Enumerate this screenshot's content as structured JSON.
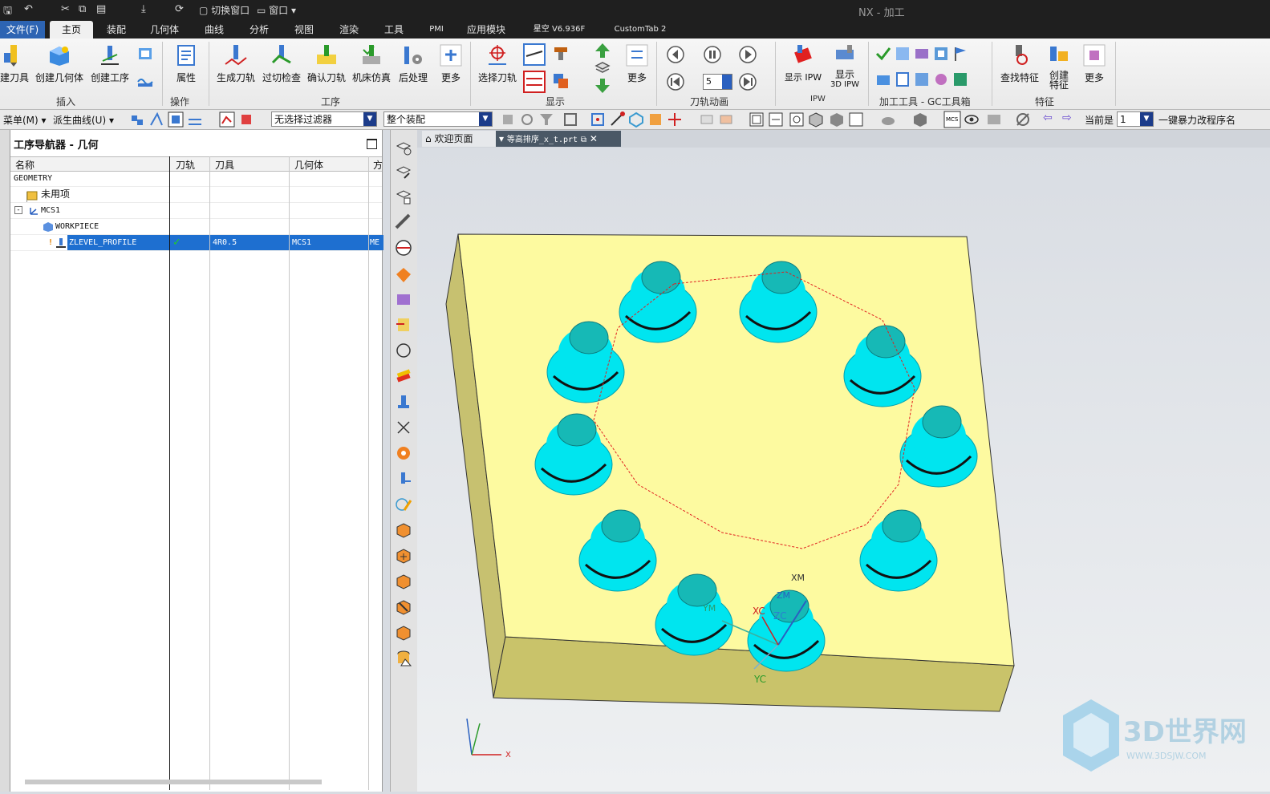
{
  "titlebar": {
    "app_title": "NX - 加工",
    "switch_window": "切换窗口",
    "window": "窗口"
  },
  "tabs": [
    {
      "label": "文件(F)"
    },
    {
      "label": "主页"
    },
    {
      "label": "装配"
    },
    {
      "label": "几何体"
    },
    {
      "label": "曲线"
    },
    {
      "label": "分析"
    },
    {
      "label": "视图"
    },
    {
      "label": "渲染"
    },
    {
      "label": "工具"
    },
    {
      "label": "PMI"
    },
    {
      "label": "应用模块"
    },
    {
      "label": "星空 V6.936F"
    },
    {
      "label": "CustomTab 2"
    }
  ],
  "ribbon": {
    "buttons": {
      "create_tool": "建刀具",
      "create_geometry": "创建几何体",
      "create_operation": "创建工序",
      "properties": "属性",
      "generate_toolpath": "生成刀轨",
      "gouge_check": "过切检查",
      "verify_toolpath": "确认刀轨",
      "machine_sim": "机床仿真",
      "postprocess": "后处理",
      "more1": "更多",
      "select_toolpath": "选择刀轨",
      "more2": "更多",
      "show_ipw": "显示 IPW",
      "show_3d_ipw_a": "显示",
      "show_3d_ipw_b": "3D IPW",
      "find_feature": "查找特征",
      "create_feature_a": "创建",
      "create_feature_b": "特征",
      "more3": "更多"
    },
    "groups": {
      "insert": "插入",
      "operation": "操作",
      "process": "工序",
      "display": "显示",
      "toolpath_anim": "刀轨动画",
      "ipw": "IPW",
      "mfg_tools": "加工工具 - GC工具箱",
      "feature": "特征"
    },
    "anim_speed": "5"
  },
  "selbar": {
    "menu": "菜单(M)",
    "derived_curves": "派生曲线(U)",
    "filter": "无选择过滤器",
    "scope": "整个装配",
    "current_label": "当前是",
    "current_value": "1",
    "rename": "一键暴力改程序名"
  },
  "navigator": {
    "title": "工序导航器 - 几何",
    "columns": [
      "名称",
      "刀轨",
      "刀具",
      "几何体",
      "方"
    ],
    "rows": [
      {
        "name": "GEOMETRY",
        "path": "",
        "tool": "",
        "geom": "",
        "method": ""
      },
      {
        "name": "未用项",
        "path": "",
        "tool": "",
        "geom": "",
        "method": ""
      },
      {
        "name": "MCS1",
        "path": "",
        "tool": "",
        "geom": "",
        "method": ""
      },
      {
        "name": "WORKPIECE",
        "path": "",
        "tool": "",
        "geom": "",
        "method": ""
      },
      {
        "name": "ZLEVEL_PROFILE",
        "path": "✓",
        "tool": "4R0.5",
        "geom": "MCS1",
        "method": "ME"
      }
    ]
  },
  "doc_tabs": {
    "welcome": "欢迎页面",
    "part": "等高排序_x_t.prt"
  },
  "viewport": {
    "axis_labels": {
      "xc": "XC",
      "yc": "YC",
      "zc": "ZC",
      "xm": "XM",
      "ym": "YM",
      "zm": "ZM",
      "x": "X"
    },
    "watermark": "3D世界网",
    "watermark_url": "WWW.3DSJW.COM",
    "colors": {
      "block_top": "#fdfaa0",
      "block_side": "#c9c36a",
      "boss": "#00e5ef",
      "boss_top": "#16b9b6",
      "toolpath": "#e02020"
    }
  }
}
